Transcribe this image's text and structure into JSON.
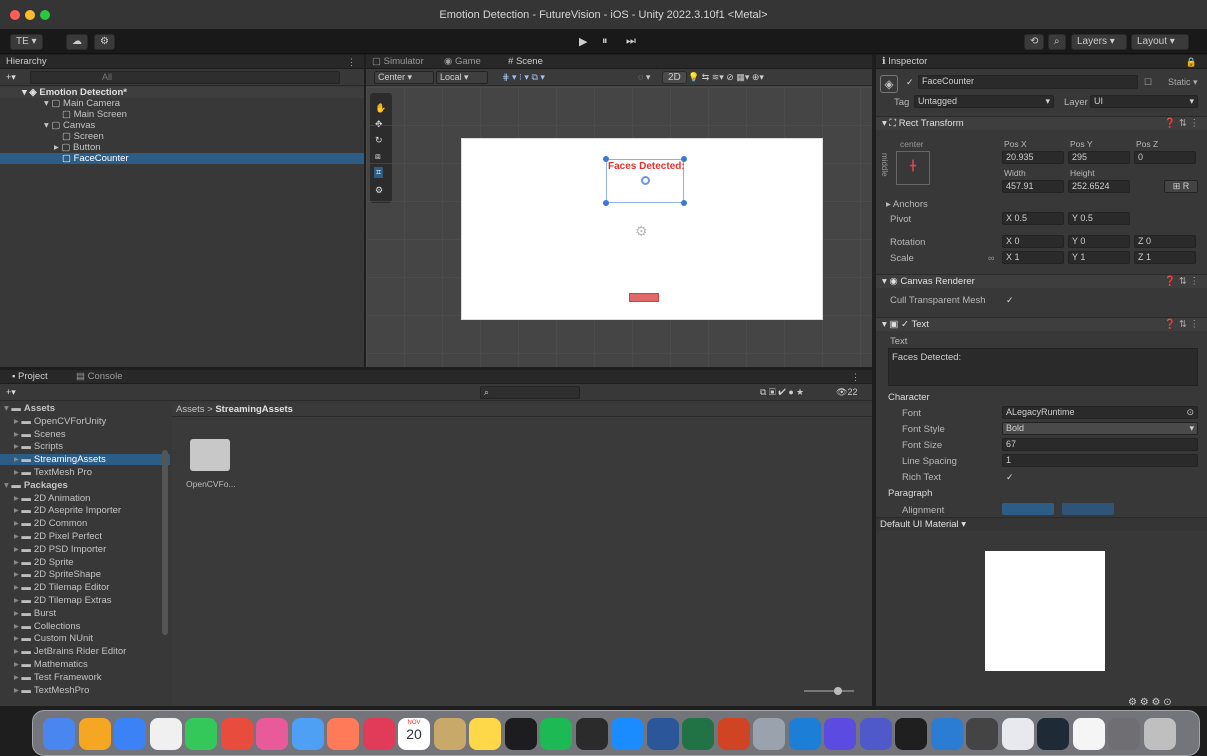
{
  "window": {
    "title": "Emotion Detection - FutureVision - iOS - Unity 2022.3.10f1 <Metal>"
  },
  "toolbar": {
    "account": "TE ▾",
    "cloud": "☁",
    "settings": "⚙",
    "play": "▶",
    "pause": "⏸",
    "step": "⏭",
    "history": "⟲",
    "search": "⌕",
    "layers": "Layers",
    "layout": "Layout"
  },
  "hierarchy": {
    "tab": "Hierarchy",
    "search_placeholder": "All",
    "add": "+▾",
    "scene": "Emotion Detection*",
    "items": [
      "Main Camera",
      "Main Screen",
      "Canvas",
      "Screen",
      "Button",
      "FaceCounter"
    ]
  },
  "scene_view": {
    "tabs": [
      "Simulator",
      "Game",
      "Scene"
    ],
    "pivot": "Center",
    "space": "Local",
    "mode_2d": "2D",
    "canvas_text": "Faces Detected:"
  },
  "project": {
    "tabs": [
      "Project",
      "Console"
    ],
    "add": "+▾",
    "badge": "22",
    "breadcrumb": [
      "Assets",
      "StreamingAssets"
    ],
    "tree": [
      {
        "label": "Assets",
        "level": 0,
        "open": true
      },
      {
        "label": "OpenCVForUnity",
        "level": 1
      },
      {
        "label": "Scenes",
        "level": 1
      },
      {
        "label": "Scripts",
        "level": 1
      },
      {
        "label": "StreamingAssets",
        "level": 1,
        "selected": true
      },
      {
        "label": "TextMesh Pro",
        "level": 1
      },
      {
        "label": "Packages",
        "level": 0,
        "open": true
      },
      {
        "label": "2D Animation",
        "level": 1
      },
      {
        "label": "2D Aseprite Importer",
        "level": 1
      },
      {
        "label": "2D Common",
        "level": 1
      },
      {
        "label": "2D Pixel Perfect",
        "level": 1
      },
      {
        "label": "2D PSD Importer",
        "level": 1
      },
      {
        "label": "2D Sprite",
        "level": 1
      },
      {
        "label": "2D SpriteShape",
        "level": 1
      },
      {
        "label": "2D Tilemap Editor",
        "level": 1
      },
      {
        "label": "2D Tilemap Extras",
        "level": 1
      },
      {
        "label": "Burst",
        "level": 1
      },
      {
        "label": "Collections",
        "level": 1
      },
      {
        "label": "Custom NUnit",
        "level": 1
      },
      {
        "label": "JetBrains Rider Editor",
        "level": 1
      },
      {
        "label": "Mathematics",
        "level": 1
      },
      {
        "label": "Test Framework",
        "level": 1
      },
      {
        "label": "TextMeshPro",
        "level": 1
      }
    ],
    "grid_items": [
      "OpenCVFo..."
    ]
  },
  "inspector": {
    "tab": "Inspector",
    "object_name": "FaceCounter",
    "static_label": "Static",
    "tag_label": "Tag",
    "tag_value": "Untagged",
    "layer_label": "Layer",
    "layer_value": "UI",
    "rect_transform": {
      "title": "Rect Transform",
      "anchor_preset_h": "center",
      "anchor_preset_v": "middle",
      "pos_x_label": "Pos X",
      "pos_x": "20.935",
      "pos_y_label": "Pos Y",
      "pos_y": "295",
      "pos_z_label": "Pos Z",
      "pos_z": "0",
      "width_label": "Width",
      "width": "457.91",
      "height_label": "Height",
      "height": "252.6524",
      "anchors_label": "Anchors",
      "pivot_label": "Pivot",
      "pivot_x": "0.5",
      "pivot_y": "0.5",
      "rotation_label": "Rotation",
      "rot_x": "0",
      "rot_y": "0",
      "rot_z": "0",
      "scale_label": "Scale",
      "scale_x": "1",
      "scale_y": "1",
      "scale_z": "1"
    },
    "canvas_renderer": {
      "title": "Canvas Renderer",
      "cull_label": "Cull Transparent Mesh",
      "cull": "✓"
    },
    "text": {
      "title": "Text",
      "text_label": "Text",
      "text_value": "Faces Detected:",
      "character_label": "Character",
      "font_label": "Font",
      "font_value": "LegacyRuntime",
      "font_style_label": "Font Style",
      "font_style_value": "Bold",
      "font_size_label": "Font Size",
      "font_size_value": "67",
      "line_spacing_label": "Line Spacing",
      "line_spacing_value": "1",
      "rich_text_label": "Rich Text",
      "rich_text_value": "✓",
      "paragraph_label": "Paragraph",
      "alignment_label": "Alignment"
    },
    "material_label": "Default UI Material"
  },
  "dock": {
    "calendar_month": "NOV",
    "calendar_day": "20",
    "icon_colors": [
      "#4a86f0",
      "#f5a623",
      "#3b82f6",
      "#f0f0f0",
      "#34c759",
      "#e84c3d",
      "#e85a9a",
      "#4ea0f5",
      "#ff7a59",
      "#e23b5a",
      "#ffffff",
      "#c8a96a",
      "#ffd84a",
      "#1d1d1f",
      "#1db954",
      "#2b2b2b",
      "#1a8cff",
      "#2b579a",
      "#217346",
      "#d04423",
      "#9aa3ad",
      "#1c7ed6",
      "#5b4be0",
      "#5059c9",
      "#1f1f1f",
      "#2b7cd3",
      "#444",
      "#e8e8ef",
      "#1e2a36",
      "#f5f5f5",
      "#6e6e73",
      "#bfbfbf"
    ]
  },
  "menubar_icons": [
    "⚙",
    "⚙",
    "⚙",
    "⊙"
  ],
  "colors": {
    "accent": "#2c5d87",
    "panel": "#383838",
    "tabbar": "#282828",
    "scene_text": "#e0322f"
  }
}
